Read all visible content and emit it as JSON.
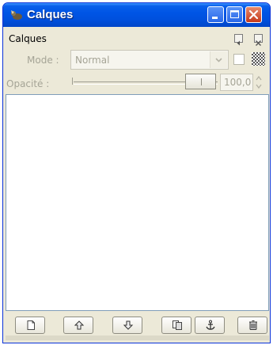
{
  "window": {
    "title": "Calques",
    "icons": {
      "app": "gimp-wilber-icon"
    }
  },
  "panel": {
    "header": "Calques",
    "mode": {
      "label": "Mode :",
      "value": "Normal"
    },
    "opacity": {
      "label": "Opacité :",
      "value": "100,0",
      "fraction": 1.0
    },
    "toolbar_icons": [
      "new-layer-icon",
      "raise-layer-icon",
      "lower-layer-icon",
      "duplicate-layer-icon",
      "anchor-layer-icon",
      "delete-layer-icon"
    ]
  },
  "colors": {
    "title_bar": "#0055e5",
    "face": "#ece9d8",
    "disabled_text": "#a5a496",
    "close_button": "#c5391a"
  }
}
